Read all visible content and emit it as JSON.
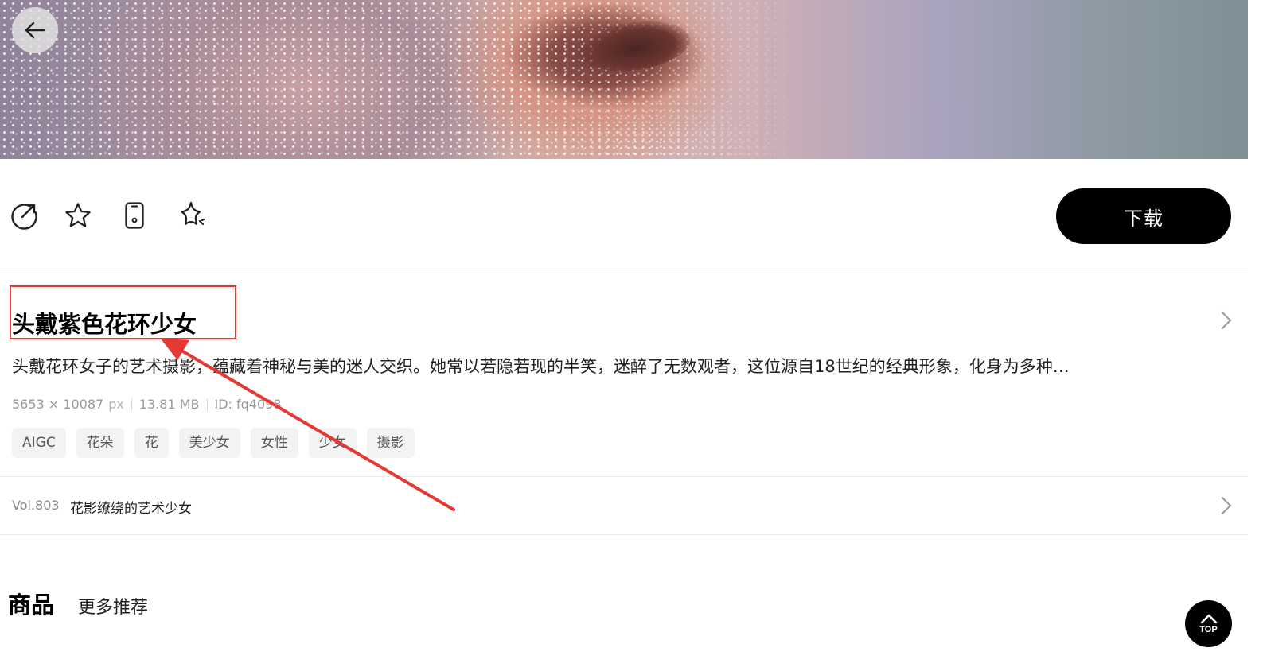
{
  "nav": {
    "back_icon": "arrow-left-icon"
  },
  "actions": {
    "icons": [
      "share-icon",
      "star-icon",
      "phone-icon",
      "sparkle-icon"
    ],
    "download_label": "下载"
  },
  "image": {
    "title": "头戴紫色花环少女",
    "description": "头戴花环女子的艺术摄影，蕴藏着神秘与美的迷人交织。她常以若隐若现的半笑，迷醉了无数观者，这位源自18世纪的经典形象，化身为多种…",
    "dimensions": "5653 × 10087",
    "dimensions_unit": "px",
    "file_size": "13.81 MB",
    "id": "ID: fq4098",
    "tags": [
      "AIGC",
      "花朵",
      "花",
      "美少女",
      "女性",
      "少女",
      "摄影"
    ]
  },
  "volume": {
    "number": "Vol.803",
    "title": "花影缭绕的艺术少女"
  },
  "tabs": {
    "active": "商品",
    "other": "更多推荐"
  },
  "scroll_top": {
    "label": "TOP"
  },
  "colors": {
    "annotation_red": "#e53935",
    "primary": "#000000"
  }
}
